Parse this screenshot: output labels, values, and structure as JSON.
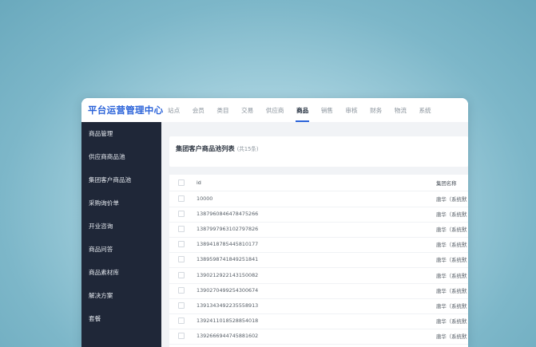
{
  "app": {
    "title": "平台运营管理中心"
  },
  "nav": {
    "items": [
      {
        "label": "站点"
      },
      {
        "label": "会员"
      },
      {
        "label": "类目"
      },
      {
        "label": "交易"
      },
      {
        "label": "供应商"
      },
      {
        "label": "商品"
      },
      {
        "label": "销售"
      },
      {
        "label": "审核"
      },
      {
        "label": "财务"
      },
      {
        "label": "物流"
      },
      {
        "label": "系统"
      }
    ],
    "active_index": 5
  },
  "sidebar": {
    "items": [
      {
        "label": "商品管理"
      },
      {
        "label": "供应商商品池"
      },
      {
        "label": "集团客户商品池"
      },
      {
        "label": "采购询价单"
      },
      {
        "label": "开业咨询"
      },
      {
        "label": "商品问答"
      },
      {
        "label": "商品素材库"
      },
      {
        "label": "解决方案"
      },
      {
        "label": "套餐"
      }
    ]
  },
  "page": {
    "title": "集团客户商品池列表",
    "count": "(共15条)"
  },
  "table": {
    "columns": [
      "id",
      "集团名称"
    ],
    "rows": [
      {
        "id": "10000",
        "name": "唐华（系统默"
      },
      {
        "id": "1387960846478475266",
        "name": "唐华（系统默"
      },
      {
        "id": "1387997963102797826",
        "name": "唐华（系统默"
      },
      {
        "id": "1389418785445810177",
        "name": "唐华（系统默"
      },
      {
        "id": "1389598741849251841",
        "name": "唐华（系统默"
      },
      {
        "id": "1390212922143150082",
        "name": "唐华（系统默"
      },
      {
        "id": "1390270499254300674",
        "name": "唐华（系统默"
      },
      {
        "id": "1391343492235558913",
        "name": "唐华（系统默"
      },
      {
        "id": "1392411018528854018",
        "name": "唐华（系统默"
      },
      {
        "id": "1392666944745881602",
        "name": "唐华（系统默"
      }
    ]
  },
  "colors": {
    "brand": "#2b63d9",
    "sidebar_bg": "#1f2738",
    "main_bg": "#f1f3f6"
  }
}
